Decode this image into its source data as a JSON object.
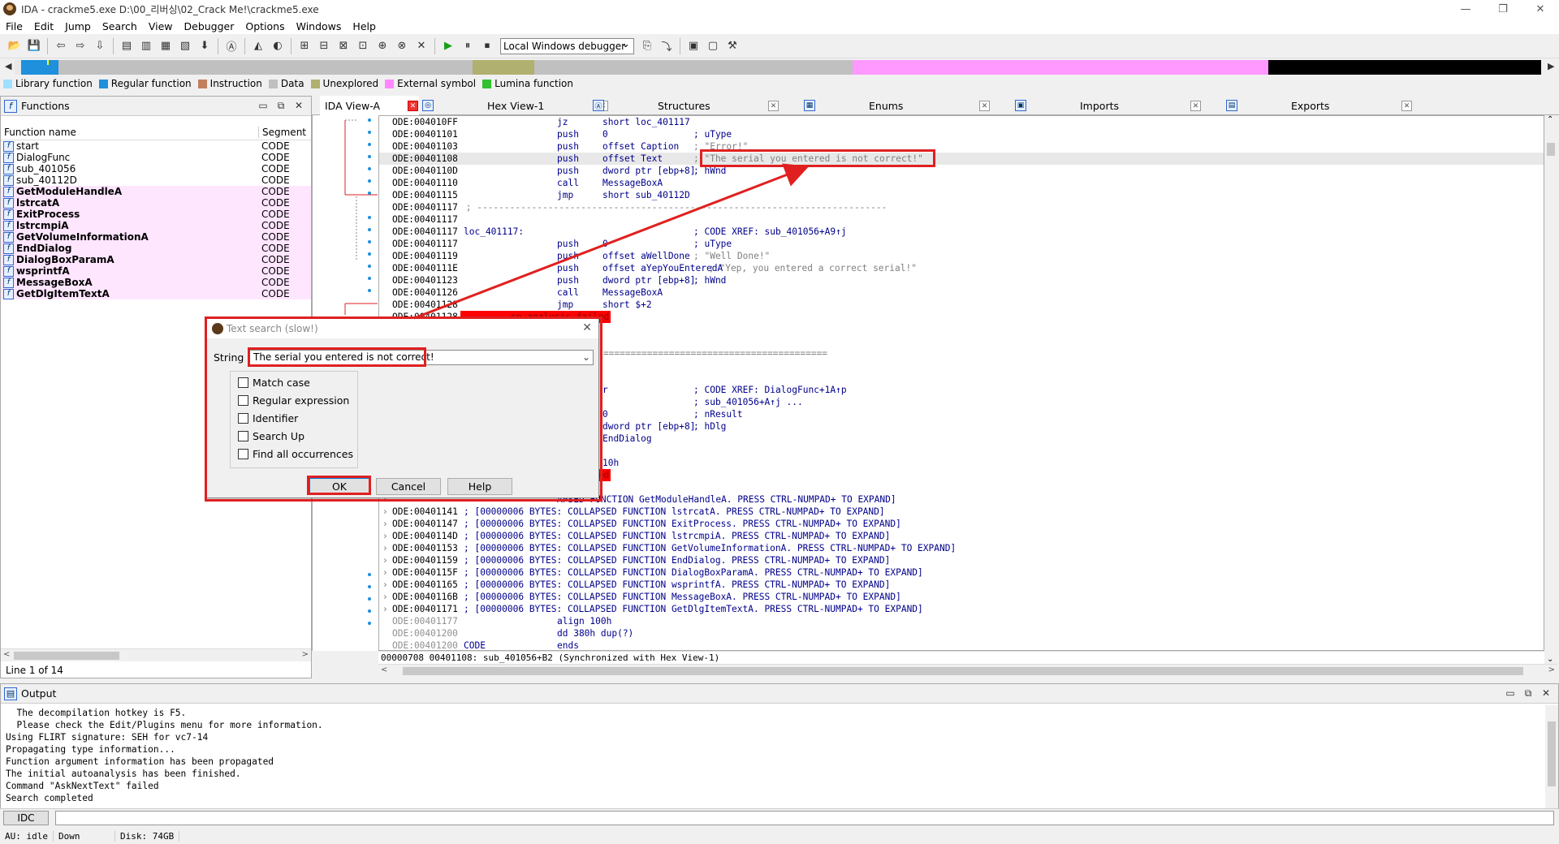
{
  "window": {
    "title": "IDA - crackme5.exe D:\\00_리버싱\\02_Crack Me!\\crackme5.exe",
    "controls": [
      "—",
      "❐",
      "✕"
    ]
  },
  "menu": [
    "File",
    "Edit",
    "Jump",
    "Search",
    "View",
    "Debugger",
    "Options",
    "Windows",
    "Help"
  ],
  "toolbar": {
    "debugger_select": "Local Windows debugger"
  },
  "legend": [
    {
      "label": "Library function",
      "color": "#a0e0ff"
    },
    {
      "label": "Regular function",
      "color": "#1e90dc"
    },
    {
      "label": "Instruction",
      "color": "#c08060"
    },
    {
      "label": "Data",
      "color": "#c0c0c0"
    },
    {
      "label": "Unexplored",
      "color": "#b0b070"
    },
    {
      "label": "External symbol",
      "color": "#ff88ff"
    },
    {
      "label": "Lumina function",
      "color": "#30c030"
    }
  ],
  "functions": {
    "title": "Functions",
    "columns": [
      "Function name",
      "Segment"
    ],
    "rows": [
      {
        "name": "start",
        "seg": "CODE",
        "lib": false
      },
      {
        "name": "DialogFunc",
        "seg": "CODE",
        "lib": false
      },
      {
        "name": "sub_401056",
        "seg": "CODE",
        "lib": false
      },
      {
        "name": "sub_40112D",
        "seg": "CODE",
        "lib": false
      },
      {
        "name": "GetModuleHandleA",
        "seg": "CODE",
        "lib": true
      },
      {
        "name": "lstrcatA",
        "seg": "CODE",
        "lib": true
      },
      {
        "name": "ExitProcess",
        "seg": "CODE",
        "lib": true
      },
      {
        "name": "lstrcmpiA",
        "seg": "CODE",
        "lib": true
      },
      {
        "name": "GetVolumeInformationA",
        "seg": "CODE",
        "lib": true
      },
      {
        "name": "EndDialog",
        "seg": "CODE",
        "lib": true
      },
      {
        "name": "DialogBoxParamA",
        "seg": "CODE",
        "lib": true
      },
      {
        "name": "wsprintfA",
        "seg": "CODE",
        "lib": true
      },
      {
        "name": "MessageBoxA",
        "seg": "CODE",
        "lib": true
      },
      {
        "name": "GetDlgItemTextA",
        "seg": "CODE",
        "lib": true
      }
    ],
    "status": "Line 1 of 14"
  },
  "tabs": [
    "IDA View-A",
    "Hex View-1",
    "Structures",
    "Enums",
    "Imports",
    "Exports"
  ],
  "disasm": [
    {
      "a": "ODE:004010FF",
      "m": "jz",
      "o": "short loc_401117",
      "c": ""
    },
    {
      "a": "ODE:00401101",
      "m": "push",
      "o": "0",
      "c": "; uType"
    },
    {
      "a": "ODE:00401103",
      "m": "push",
      "o": "offset Caption",
      "c": "; \"Error!\"",
      "cg": true
    },
    {
      "a": "ODE:00401108",
      "m": "push",
      "o": "offset Text",
      "c": "; \"The serial you entered is not correct!\"",
      "cg": true,
      "hl": true
    },
    {
      "a": "ODE:0040110D",
      "m": "push",
      "o": "dword ptr [ebp+8]",
      "c": "; hWnd"
    },
    {
      "a": "ODE:00401110",
      "m": "call",
      "o": "MessageBoxA",
      "c": ""
    },
    {
      "a": "ODE:00401115",
      "m": "jmp",
      "o": "short sub_40112D",
      "c": ""
    },
    {
      "a": "ODE:00401117",
      "raw": " ; ---------------------------------------------------------------------------"
    },
    {
      "a": "ODE:00401117",
      "m": "",
      "o": "",
      "c": ""
    },
    {
      "a": "ODE:00401117",
      "lbl": "loc_401117:",
      "c": "; CODE XREF: sub_401056+A9↑j"
    },
    {
      "a": "ODE:00401117",
      "m": "push",
      "o": "0",
      "c": "; uType"
    },
    {
      "a": "ODE:00401119",
      "m": "push",
      "o": "offset aWellDone",
      "c": "; \"Well Done!\"",
      "cg": true
    },
    {
      "a": "ODE:0040111E",
      "m": "push",
      "o": "offset aYepYouEnteredA",
      "c": "; \"Yep, you entered a correct serial!\"",
      "cg": true,
      "shift": true
    },
    {
      "a": "ODE:00401123",
      "m": "push",
      "o": "dword ptr [ebp+8]",
      "c": "; hWnd"
    },
    {
      "a": "ODE:00401126",
      "m": "call",
      "o": "MessageBoxA",
      "c": ""
    },
    {
      "a": "ODE:00401128",
      "m": "jmp",
      "o": "short $+2",
      "c": ""
    },
    {
      "a": "ODE:00401128",
      "red": "sp-analysis failed"
    },
    {
      "a": "",
      "m": "",
      "o": "",
      "c": ""
    },
    {
      "a": "",
      "m": "",
      "o": "",
      "c": ""
    },
    {
      "a": "",
      "raw": "ROUTINE ========================================="
    },
    {
      "a": "",
      "m": "",
      "o": "",
      "c": ""
    },
    {
      "a": "",
      "m": "",
      "o": "",
      "c": ""
    },
    {
      "a": "",
      "m": "",
      "o": "r",
      "c": "; CODE XREF: DialogFunc+1A↑p"
    },
    {
      "a": "",
      "m": "",
      "o": "",
      "c": "; sub_401056+A↑j ..."
    },
    {
      "a": "",
      "m": "",
      "o": "0",
      "c": "; nResult"
    },
    {
      "a": "",
      "m": "",
      "o": "dword ptr [ebp+8]",
      "c": "; hDlg"
    },
    {
      "a": "",
      "m": "",
      "o": "EndDialog",
      "c": ""
    },
    {
      "a": "",
      "m": "",
      "o": "",
      "c": ""
    },
    {
      "a": "",
      "m": "",
      "o": "10h",
      "c": ""
    },
    {
      "a": "",
      "red": "sp-analysis failed"
    },
    {
      "a": "",
      "m": "",
      "o": "",
      "c": ""
    },
    {
      "a": "",
      "coll": "; [00000006 BYTES: COLLAPSED FUNCTION GetModuleHandleA. PRESS CTRL-NUMPAD+ TO EXPAND]",
      "pre": "APSED FUNCTION GetModuleHandleA. PRESS CTRL-NUMPAD+ TO EXPAND]"
    },
    {
      "a": "ODE:00401141",
      "coll": "; [00000006 BYTES: COLLAPSED FUNCTION lstrcatA. PRESS CTRL-NUMPAD+ TO EXPAND]"
    },
    {
      "a": "ODE:00401147",
      "coll": "; [00000006 BYTES: COLLAPSED FUNCTION ExitProcess. PRESS CTRL-NUMPAD+ TO EXPAND]"
    },
    {
      "a": "ODE:0040114D",
      "coll": "; [00000006 BYTES: COLLAPSED FUNCTION lstrcmpiA. PRESS CTRL-NUMPAD+ TO EXPAND]"
    },
    {
      "a": "ODE:00401153",
      "coll": "; [00000006 BYTES: COLLAPSED FUNCTION GetVolumeInformationA. PRESS CTRL-NUMPAD+ TO EXPAND]"
    },
    {
      "a": "ODE:00401159",
      "coll": "; [00000006 BYTES: COLLAPSED FUNCTION EndDialog. PRESS CTRL-NUMPAD+ TO EXPAND]"
    },
    {
      "a": "ODE:0040115F",
      "coll": "; [00000006 BYTES: COLLAPSED FUNCTION DialogBoxParamA. PRESS CTRL-NUMPAD+ TO EXPAND]"
    },
    {
      "a": "ODE:00401165",
      "coll": "; [00000006 BYTES: COLLAPSED FUNCTION wsprintfA. PRESS CTRL-NUMPAD+ TO EXPAND]"
    },
    {
      "a": "ODE:0040116B",
      "coll": "; [00000006 BYTES: COLLAPSED FUNCTION MessageBoxA. PRESS CTRL-NUMPAD+ TO EXPAND]"
    },
    {
      "a": "ODE:00401171",
      "coll": "; [00000006 BYTES: COLLAPSED FUNCTION GetDlgItemTextA. PRESS CTRL-NUMPAD+ TO EXPAND]"
    },
    {
      "a": "ODE:00401177",
      "m": "align 100h",
      "o": "",
      "c": "",
      "g": true
    },
    {
      "a": "ODE:00401200",
      "m": "dd 380h dup(?)",
      "o": "",
      "c": "",
      "g": true
    },
    {
      "a": "ODE:00401200",
      "m": "ends",
      "o": "",
      "c": "",
      "g": true,
      "lbl2": "CODE"
    }
  ],
  "disasm_status": "00000708 00401108: sub_401056+B2 (Synchronized with Hex View-1)",
  "output": {
    "title": "Output",
    "lines": [
      "  The decompilation hotkey is F5.",
      "  Please check the Edit/Plugins menu for more information.",
      "Using FLIRT signature: SEH for vc7-14",
      "Propagating type information...",
      "Function argument information has been propagated",
      "The initial autoanalysis has been finished.",
      "Command \"AskNextText\" failed",
      "Search completed"
    ]
  },
  "idc": {
    "button": "IDC"
  },
  "status": {
    "au": "AU:  idle",
    "dir": "Down",
    "disk": "Disk: 74GB"
  },
  "dialog": {
    "title": "Text search (slow!)",
    "string_label": "String",
    "string_value": "The serial you entered is not correct!",
    "options": [
      "Match case",
      "Regular expression",
      "Identifier",
      "Search Up",
      "Find all occurrences"
    ],
    "ok": "OK",
    "cancel": "Cancel",
    "help": "Help"
  }
}
